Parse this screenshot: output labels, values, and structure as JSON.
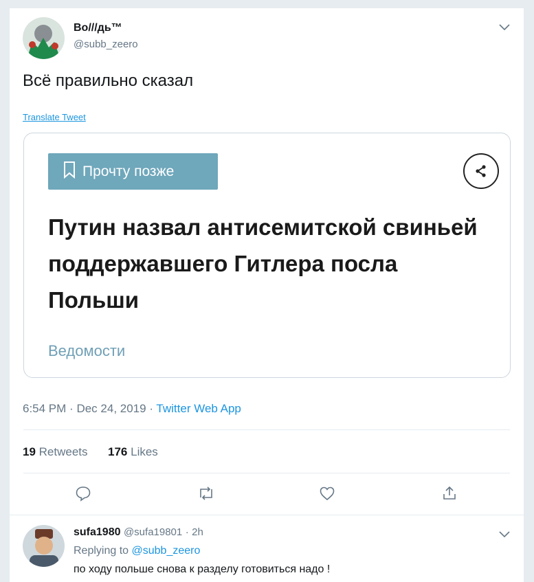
{
  "tweet": {
    "display_name": "Во///дь™",
    "handle": "@subb_zeero",
    "text": "Всё правильно сказал",
    "translate_label": "Translate Tweet",
    "card": {
      "read_later_label": "Прочту позже",
      "headline": "Путин назвал антисемитской свиньей поддержавшего Гитлера посла Польши",
      "source": "Ведомости"
    },
    "time": "6:54 PM",
    "date": "Dec 24, 2019",
    "separator": "·",
    "via": "Twitter Web App",
    "retweets_count": "19",
    "retweets_label": "Retweets",
    "likes_count": "176",
    "likes_label": "Likes"
  },
  "reply": {
    "display_name": "sufa1980",
    "handle": "@sufa19801",
    "time_ago": "2h",
    "replying_prefix": "Replying to",
    "replying_to": "@subb_zeero",
    "text": "по ходу польше снова к разделу готовиться надо !"
  },
  "icons": [
    "chevron-down-icon",
    "bookmark-icon",
    "share-icon",
    "reply-icon",
    "retweet-icon",
    "like-icon",
    "share-tweet-icon"
  ],
  "colors": {
    "accent": "#1b95e0",
    "muted": "#657786",
    "card_button": "#6fa7bb"
  }
}
